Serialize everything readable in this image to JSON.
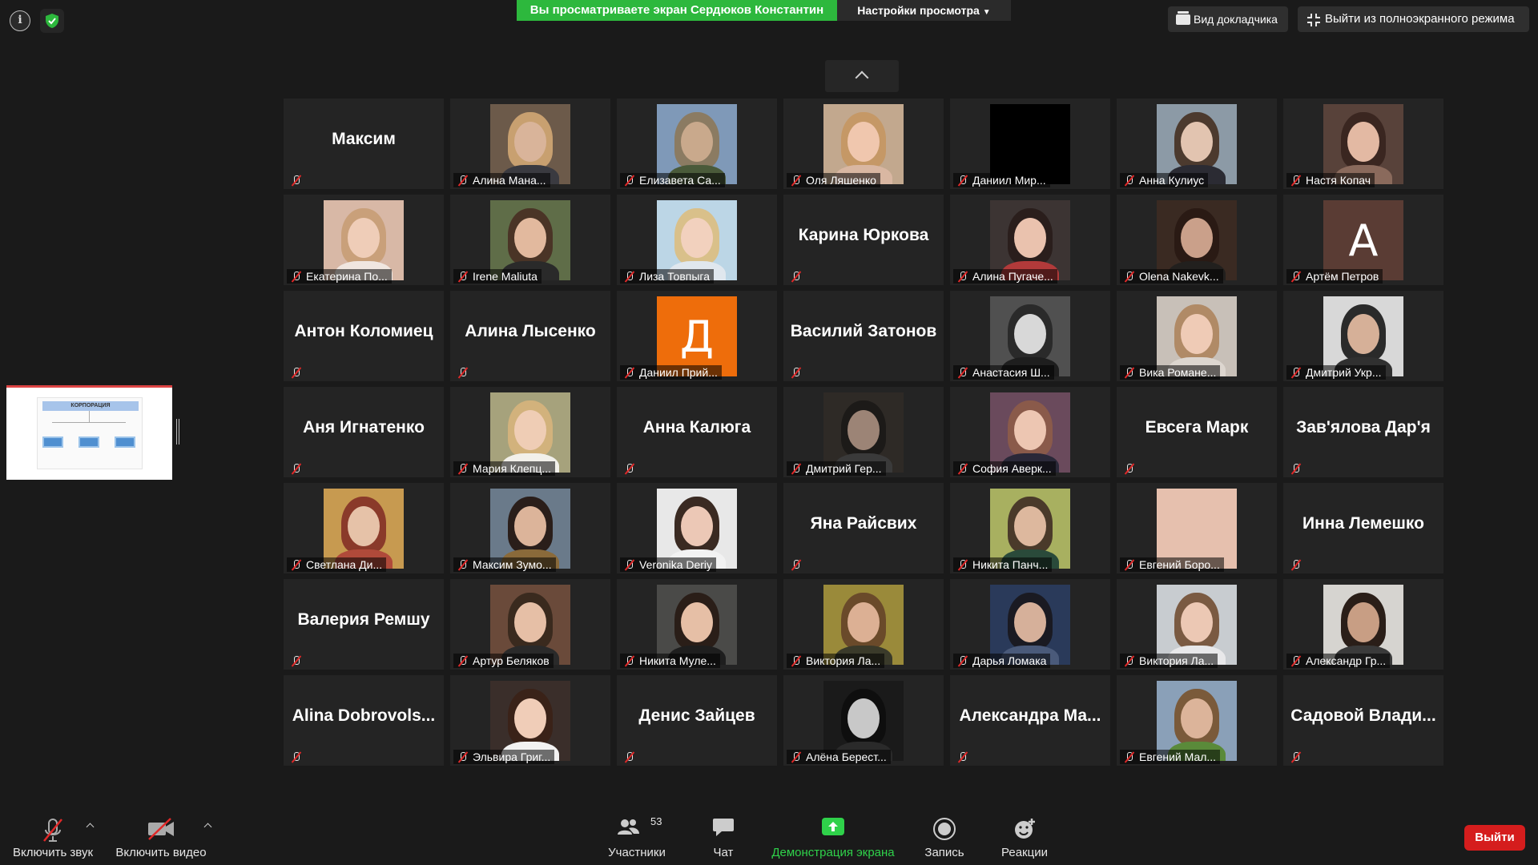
{
  "top_bar": {
    "share_banner": "Вы просматриваете экран Сердюков Константин",
    "view_options": "Настройки просмотра",
    "speaker_view": "Вид докладчика",
    "exit_fullscreen": "Выйти из полноэкранного режима"
  },
  "share_thumbnail": {
    "slide_title": "КОРПОРАЦИЯ"
  },
  "participants": [
    {
      "name": "Максим",
      "video": false,
      "muted": true,
      "big_name": "Максим"
    },
    {
      "name": "Алина Мана...",
      "video": true,
      "muted": true,
      "colors": [
        "#6c5a4a",
        "#d9b49a",
        "#c8a070",
        "#3a3a40"
      ]
    },
    {
      "name": "Елизавета Са...",
      "video": true,
      "muted": true,
      "colors": [
        "#7f99b8",
        "#c9a98c",
        "#8b7b62",
        "#4a5a3a"
      ]
    },
    {
      "name": "Оля Ляшенко",
      "video": true,
      "muted": true,
      "colors": [
        "#c2a88e",
        "#f0c7ae",
        "#c59866",
        "#d9b7a2"
      ]
    },
    {
      "name": "Даниил Мир...",
      "video": true,
      "muted": true,
      "colors": [
        "#000000",
        "#000000",
        "#000000",
        "#000000"
      ]
    },
    {
      "name": "Анна Кулиус",
      "video": true,
      "muted": true,
      "colors": [
        "#8c9aa6",
        "#e2c4b0",
        "#4c3a2e",
        "#2b2b33"
      ]
    },
    {
      "name": "Настя Копач",
      "video": true,
      "muted": true,
      "colors": [
        "#58423a",
        "#e3b9a3",
        "#3a2620",
        "#8a6a5c"
      ]
    },
    {
      "name": "Екатерина По...",
      "video": true,
      "muted": true,
      "colors": [
        "#d8b8a6",
        "#efcdb8",
        "#c9a07a",
        "#f0e6e0"
      ]
    },
    {
      "name": "Irene Maliuta",
      "video": true,
      "muted": true,
      "colors": [
        "#5f6d48",
        "#e2b99e",
        "#4a3426",
        "#2a2a2a"
      ]
    },
    {
      "name": "Лиза Товпыга",
      "video": true,
      "muted": true,
      "colors": [
        "#bcd6e6",
        "#f2d1be",
        "#d9c08a",
        "#e0e7ee"
      ]
    },
    {
      "name": "Карина Юркова",
      "video": false,
      "muted": true,
      "big_name": "Карина Юркова"
    },
    {
      "name": "Алина Пугаче...",
      "video": true,
      "muted": true,
      "colors": [
        "#3c3433",
        "#eac2ae",
        "#2a1e1c",
        "#b23a3a"
      ]
    },
    {
      "name": "Olena Nakevk...",
      "video": true,
      "muted": true,
      "colors": [
        "#3a2a22",
        "#caa08a",
        "#2a1a14",
        "#22201e"
      ]
    },
    {
      "name": "Артём Петров",
      "video": false,
      "muted": true,
      "initial": "А",
      "initial_bg": "#5a3c34"
    },
    {
      "name": "Антон Коломиец",
      "video": false,
      "muted": true,
      "big_name": "Антон Коломиец"
    },
    {
      "name": "Алина Лысенко",
      "video": false,
      "muted": true,
      "big_name": "Алина Лысенко"
    },
    {
      "name": "Даниил Прий...",
      "video": false,
      "muted": true,
      "initial": "Д",
      "initial_bg": "#ee6d0b"
    },
    {
      "name": "Василий Затонов",
      "video": false,
      "muted": true,
      "big_name": "Василий Затонов"
    },
    {
      "name": "Анастасия Ш...",
      "video": true,
      "muted": true,
      "colors": [
        "#505050",
        "#d8d8d8",
        "#2a2a2a",
        "#1e1e1e"
      ]
    },
    {
      "name": "Вика Романе...",
      "video": true,
      "muted": true,
      "colors": [
        "#c8c0b8",
        "#efcbb6",
        "#b08a66",
        "#ddd6cf"
      ]
    },
    {
      "name": "Дмитрий Укр...",
      "video": true,
      "muted": true,
      "colors": [
        "#d8d8d8",
        "#d6b098",
        "#2a2a2a",
        "#303030"
      ]
    },
    {
      "name": "Аня Игнатенко",
      "video": false,
      "muted": true,
      "big_name": "Аня Игнатенко"
    },
    {
      "name": "Мария Клепц...",
      "video": true,
      "muted": true,
      "colors": [
        "#a6a27c",
        "#efcdb5",
        "#d2b27c",
        "#f2f0ea"
      ]
    },
    {
      "name": "Анна Калюга",
      "video": false,
      "muted": true,
      "big_name": "Анна Калюга"
    },
    {
      "name": "Дмитрий Гер...",
      "video": true,
      "muted": true,
      "colors": [
        "#2e2a26",
        "#9c8476",
        "#1c1a18",
        "#3a3a3a"
      ]
    },
    {
      "name": "София Аверк...",
      "video": true,
      "muted": true,
      "colors": [
        "#6a4a5c",
        "#edc6b2",
        "#8a5a4a",
        "#2a2838"
      ]
    },
    {
      "name": "Евсега Марк",
      "video": false,
      "muted": true,
      "big_name": "Евсега Марк"
    },
    {
      "name": "Зав'ялова Дар'я",
      "video": false,
      "muted": true,
      "big_name": "Зав'ялова Дар'я"
    },
    {
      "name": "Светлана Ди...",
      "video": true,
      "muted": true,
      "colors": [
        "#c79a50",
        "#e6c2a8",
        "#8a3a2a",
        "#b04a3a"
      ]
    },
    {
      "name": "Максим Зумо...",
      "video": true,
      "muted": true,
      "colors": [
        "#6a7a8a",
        "#dcb49a",
        "#2a1e1a",
        "#8a6a3a"
      ]
    },
    {
      "name": "Veronika Deriy",
      "video": true,
      "muted": true,
      "colors": [
        "#e8e8e8",
        "#ecc8b6",
        "#3a2a22",
        "#f2f2f2"
      ]
    },
    {
      "name": "Яна Райсвих",
      "video": false,
      "muted": true,
      "big_name": "Яна Райсвих"
    },
    {
      "name": "Никита Панч...",
      "video": true,
      "muted": true,
      "colors": [
        "#a8b060",
        "#ddb89e",
        "#4a3a2a",
        "#2a4a3a"
      ]
    },
    {
      "name": "Евгений Боро...",
      "video": true,
      "muted": true,
      "colors": [
        "#e6c0ae",
        "#e6c0ae",
        "#e6c0ae",
        "#e6c0ae"
      ]
    },
    {
      "name": "Инна Лемешко",
      "video": false,
      "muted": true,
      "big_name": "Инна Лемешко"
    },
    {
      "name": "Валерия Ремшу",
      "video": false,
      "muted": true,
      "big_name": "Валерия Ремшу"
    },
    {
      "name": "Артур Беляков",
      "video": true,
      "muted": true,
      "colors": [
        "#6a4a3a",
        "#e6bfa6",
        "#3a2a1e",
        "#2a2a2a"
      ]
    },
    {
      "name": "Никита Муле...",
      "video": true,
      "muted": true,
      "colors": [
        "#4a4a48",
        "#e6bfa6",
        "#2a1e18",
        "#1e1e1e"
      ]
    },
    {
      "name": "Виктория Ла...",
      "video": true,
      "muted": true,
      "colors": [
        "#9a8a3a",
        "#dcb094",
        "#6a4a2a",
        "#3a3a2a"
      ]
    },
    {
      "name": "Дарья Ломака",
      "video": true,
      "muted": true,
      "colors": [
        "#2a3a5a",
        "#d6b09a",
        "#1a1a22",
        "#4a5a7a"
      ]
    },
    {
      "name": "Виктория Ла...",
      "video": true,
      "muted": true,
      "colors": [
        "#c8ccd0",
        "#ecc8b4",
        "#7a5a42",
        "#e8e8ea"
      ]
    },
    {
      "name": "Александр Гр...",
      "video": true,
      "muted": true,
      "colors": [
        "#d6d4d0",
        "#c89e84",
        "#2a1e18",
        "#3a3a3a"
      ]
    },
    {
      "name": "Alina  Dobrovols...",
      "video": false,
      "muted": true,
      "big_name": "Alina  Dobrovols..."
    },
    {
      "name": "Эльвира Григ...",
      "video": true,
      "muted": true,
      "colors": [
        "#3a2e2a",
        "#f0cdb8",
        "#3a2218",
        "#f2f2f2"
      ]
    },
    {
      "name": "Денис Зайцев",
      "video": false,
      "muted": true,
      "big_name": "Денис Зайцев"
    },
    {
      "name": "Алёна Берест...",
      "video": true,
      "muted": true,
      "colors": [
        "#1a1a1a",
        "#c8c8c8",
        "#0e0e0e",
        "#2a2a2a"
      ]
    },
    {
      "name": "Александра  Ма...",
      "video": false,
      "muted": true,
      "big_name": "Александра  Ма..."
    },
    {
      "name": "Евгений Мал...",
      "video": true,
      "muted": true,
      "colors": [
        "#8aa0b8",
        "#dcb49a",
        "#7a5a3a",
        "#5a8a3a"
      ]
    },
    {
      "name": "Садовой  Влади...",
      "video": false,
      "muted": true,
      "big_name": "Садовой  Влади..."
    }
  ],
  "toolbar": {
    "unmute": "Включить звук",
    "start_video": "Включить видео",
    "participants": "Участники",
    "participants_count": "53",
    "chat": "Чат",
    "share_screen": "Демонстрация экрана",
    "record": "Запись",
    "reactions": "Реакции",
    "leave": "Выйти"
  },
  "colors": {
    "share_banner": "#2db83d",
    "leave": "#d51d1d",
    "mute_slash": "#e02828",
    "share_green": "#2fd14a"
  }
}
